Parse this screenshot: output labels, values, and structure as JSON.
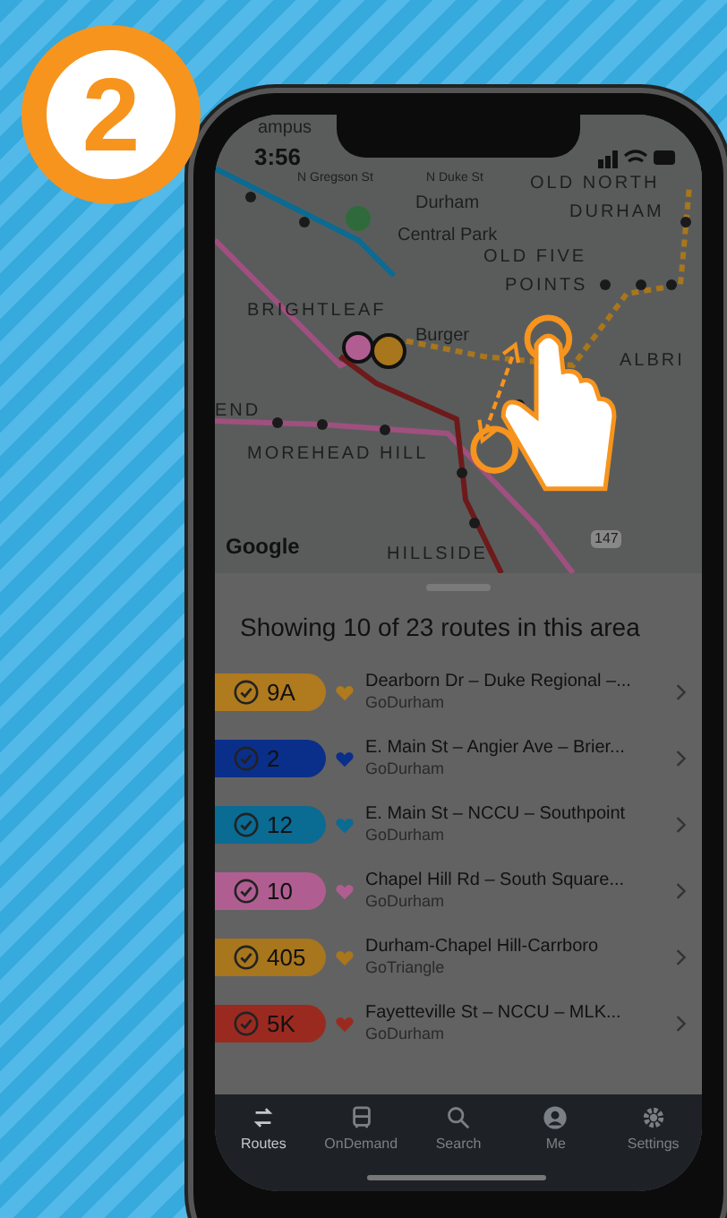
{
  "step_badge": "2",
  "status_bar": {
    "time": "3:56"
  },
  "map": {
    "labels": [
      {
        "text": "ampus",
        "kind": "place"
      },
      {
        "text": "OLD NORTH",
        "kind": "district"
      },
      {
        "text": "DURHAM",
        "kind": "district"
      },
      {
        "text": "N Gregson St",
        "kind": "street"
      },
      {
        "text": "N Duke St",
        "kind": "street"
      },
      {
        "text": "Durham",
        "kind": "place"
      },
      {
        "text": "Central Park",
        "kind": "place"
      },
      {
        "text": "OLD FIVE",
        "kind": "district"
      },
      {
        "text": "POINTS",
        "kind": "district"
      },
      {
        "text": "BRIGHTLEAF",
        "kind": "district"
      },
      {
        "text": "Burger",
        "kind": "place"
      },
      {
        "text": "ALBRI",
        "kind": "district"
      },
      {
        "text": "END",
        "kind": "district"
      },
      {
        "text": "MOREHEAD HILL",
        "kind": "district"
      },
      {
        "text": "HILLSIDE",
        "kind": "district"
      },
      {
        "text": "147",
        "kind": "shield"
      }
    ],
    "attribution": "Google"
  },
  "heading": "Showing 10 of 23 routes in this area",
  "routes": [
    {
      "number": "9A",
      "color": "#b07a1e",
      "checked": true,
      "title": "Dearborn Dr – Duke Regional –...",
      "agency": "GoDurham"
    },
    {
      "number": "2",
      "color": "#0a2f8a",
      "checked": true,
      "title": "E. Main St – Angier Ave – Brier...",
      "agency": "GoDurham"
    },
    {
      "number": "12",
      "color": "#0a6b93",
      "checked": true,
      "title": "E. Main St – NCCU – Southpoint",
      "agency": "GoDurham"
    },
    {
      "number": "10",
      "color": "#b05e92",
      "checked": true,
      "title": "Chapel Hill Rd – South Square...",
      "agency": "GoDurham"
    },
    {
      "number": "405",
      "color": "#a8761c",
      "checked": true,
      "title": "Durham-Chapel Hill-Carrboro",
      "agency": "GoTriangle"
    },
    {
      "number": "5K",
      "color": "#9a2a20",
      "checked": true,
      "title": "Fayetteville St – NCCU – MLK...",
      "agency": "GoDurham"
    }
  ],
  "tabs": [
    {
      "label": "Routes",
      "selected": true
    },
    {
      "label": "OnDemand",
      "selected": false
    },
    {
      "label": "Search",
      "selected": false
    },
    {
      "label": "Me",
      "selected": false
    },
    {
      "label": "Settings",
      "selected": false
    }
  ]
}
